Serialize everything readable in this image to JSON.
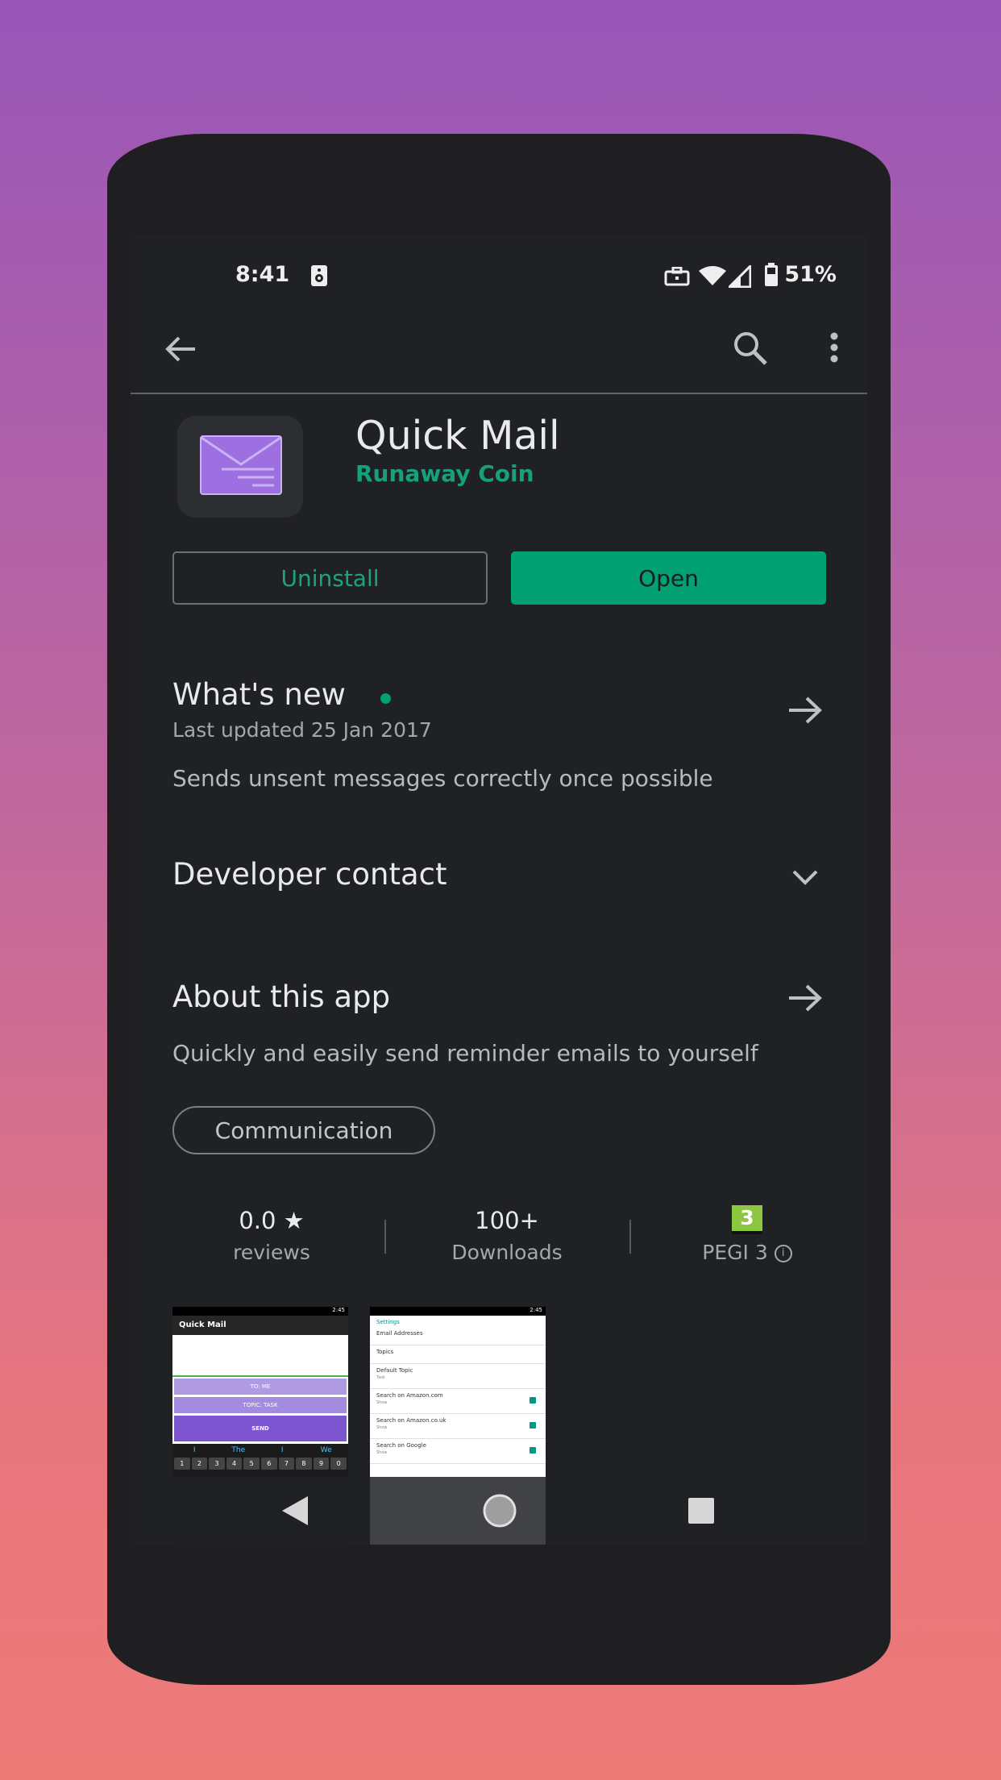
{
  "status_bar": {
    "time": "8:41",
    "battery_percent": "51%",
    "icons": [
      "speaker-icon",
      "briefcase-icon",
      "wifi-icon",
      "signal-icon",
      "battery-icon"
    ]
  },
  "app_bar": {
    "icons": [
      "back-arrow-icon",
      "search-icon",
      "more-vert-icon"
    ]
  },
  "app": {
    "title": "Quick Mail",
    "developer": "Runaway Coin",
    "icon": "envelope-icon"
  },
  "buttons": {
    "uninstall": "Uninstall",
    "open": "Open"
  },
  "whats_new": {
    "title": "What's new",
    "updated": "Last updated 25 Jan 2017",
    "text": "Sends unsent messages correctly once possible"
  },
  "developer_contact": {
    "title": "Developer contact"
  },
  "about": {
    "title": "About this app",
    "text": "Quickly and easily send reminder emails to yourself",
    "chip": "Communication"
  },
  "stats": {
    "rating": "0.0",
    "rating_label": "reviews",
    "downloads": "100+",
    "downloads_label": "Downloads",
    "pegi_badge": "3",
    "pegi_label": "PEGI 3"
  },
  "screenshot1": {
    "time": "2:45",
    "title": "Quick Mail",
    "to_me": "TO: ME",
    "topic": "TOPIC: TASK",
    "send": "SEND",
    "suggestions": [
      "I",
      "The",
      "I",
      "We"
    ],
    "number_row": [
      "1",
      "2",
      "3",
      "4",
      "5",
      "6",
      "7",
      "8",
      "9",
      "0"
    ]
  },
  "screenshot2": {
    "time": "2:45",
    "header": "Settings",
    "rows": [
      {
        "title": "Email Addresses",
        "sub": ""
      },
      {
        "title": "Topics",
        "sub": ""
      },
      {
        "title": "Default Topic",
        "sub": "Task"
      },
      {
        "title": "Search on Amazon.com",
        "sub": "Show"
      },
      {
        "title": "Search on Amazon.co.uk",
        "sub": "Show"
      },
      {
        "title": "Search on Google",
        "sub": "Show"
      }
    ]
  },
  "colors": {
    "accent": "#01a173",
    "background": "#202124",
    "app_icon": "#9d6fe0"
  }
}
